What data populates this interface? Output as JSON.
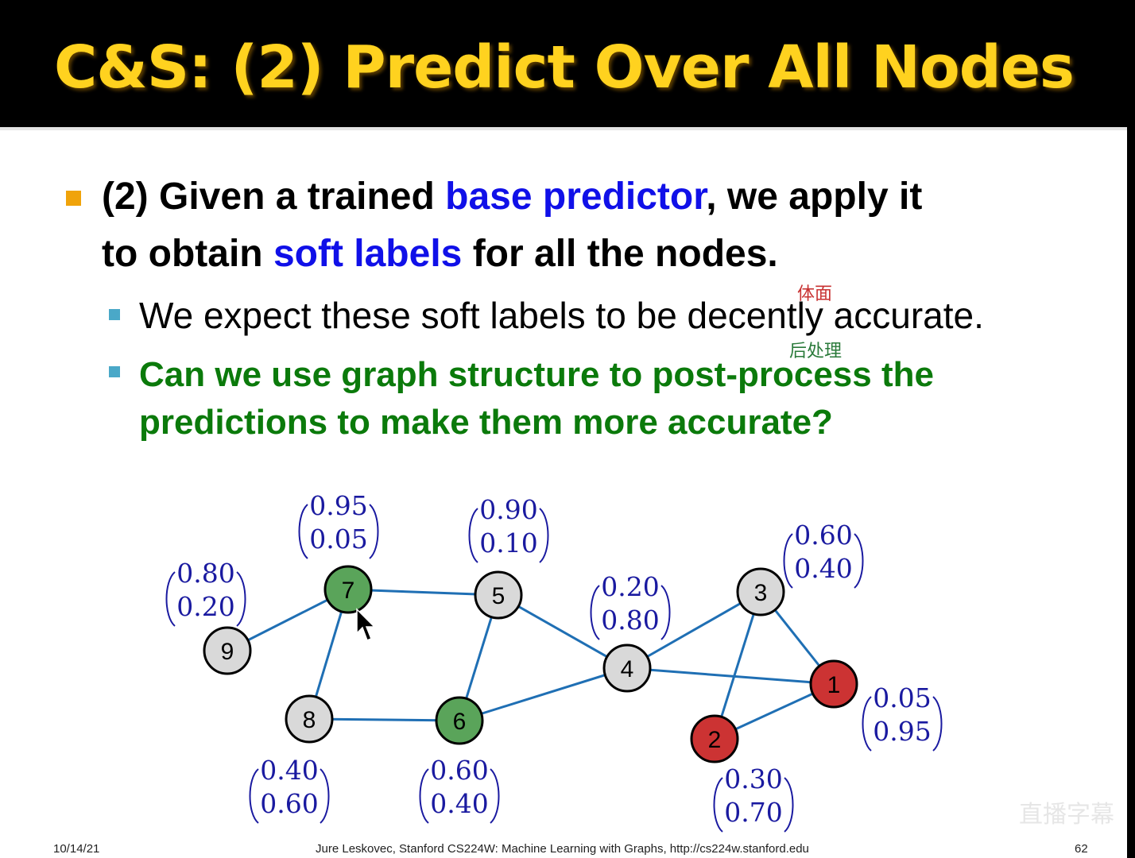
{
  "slide": {
    "title": "C&S: (2) Predict Over All Nodes",
    "bullet1": {
      "part1": "(2) Given a trained ",
      "emph1": "base predictor",
      "part2": ", we apply it",
      "part3": "to obtain ",
      "emph2": "soft labels",
      "part4": " for all the nodes."
    },
    "sub_bullets": [
      "We expect these soft labels to be decently accurate.",
      "Can we use graph structure to post-process the",
      "predictions to make them more accurate?"
    ],
    "annotations": [
      "体面",
      "后处理"
    ]
  },
  "colors": {
    "title": "#ffd21f",
    "emphasis_blue": "#1010e8",
    "green_text": "#0b7a0b",
    "edge": "#1f6fb4",
    "node_green": "#5aa45a",
    "node_red": "#cc3333",
    "node_gray": "#d9d9d9",
    "vector": "#1a1aa0"
  },
  "graph": {
    "nodes": [
      {
        "id": "1",
        "class": "red",
        "probs": [
          "0.05",
          "0.95"
        ]
      },
      {
        "id": "2",
        "class": "red",
        "probs": [
          "0.30",
          "0.70"
        ]
      },
      {
        "id": "3",
        "class": "gray",
        "probs": [
          "0.60",
          "0.40"
        ]
      },
      {
        "id": "4",
        "class": "gray",
        "probs": [
          "0.20",
          "0.80"
        ]
      },
      {
        "id": "5",
        "class": "gray",
        "probs": [
          "0.90",
          "0.10"
        ]
      },
      {
        "id": "6",
        "class": "green",
        "probs": [
          "0.60",
          "0.40"
        ]
      },
      {
        "id": "7",
        "class": "green",
        "probs": [
          "0.95",
          "0.05"
        ]
      },
      {
        "id": "8",
        "class": "gray",
        "probs": [
          "0.40",
          "0.60"
        ]
      },
      {
        "id": "9",
        "class": "gray",
        "probs": [
          "0.80",
          "0.20"
        ]
      }
    ],
    "edges": [
      [
        "9",
        "7"
      ],
      [
        "7",
        "8"
      ],
      [
        "7",
        "5"
      ],
      [
        "5",
        "6"
      ],
      [
        "5",
        "4"
      ],
      [
        "8",
        "6"
      ],
      [
        "6",
        "4"
      ],
      [
        "4",
        "3"
      ],
      [
        "4",
        "1"
      ],
      [
        "3",
        "1"
      ],
      [
        "3",
        "2"
      ],
      [
        "2",
        "1"
      ]
    ]
  },
  "footer": {
    "date": "10/14/21",
    "credit": "Jure Leskovec, Stanford CS224W: Machine Learning with Graphs, http://cs224w.stanford.edu",
    "page": "62"
  },
  "watermark": "直播字幕"
}
